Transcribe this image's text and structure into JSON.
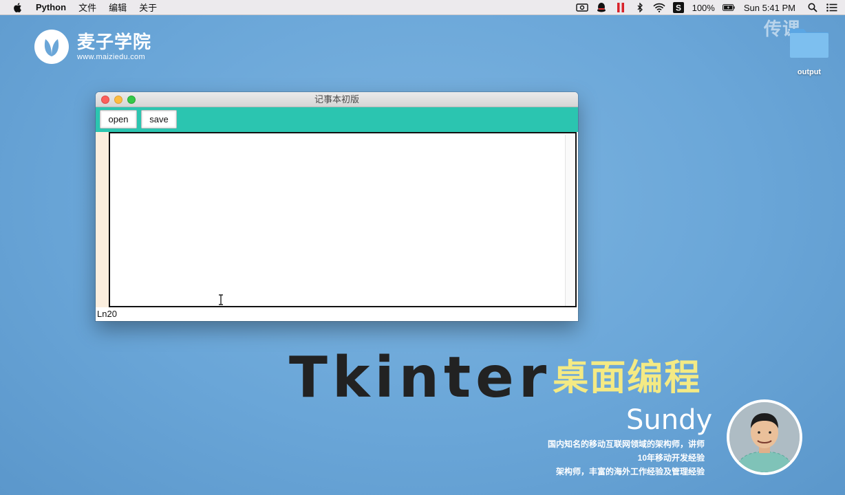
{
  "menubar": {
    "app_name": "Python",
    "items": [
      "文件",
      "编辑",
      "关于"
    ],
    "status": {
      "battery": "100%",
      "clock": "Sun 5:41 PM"
    }
  },
  "desktop": {
    "logo": {
      "title": "麦子学院",
      "url": "www.maiziedu.com"
    },
    "watermark": "传课",
    "folder_label": "output"
  },
  "window": {
    "title": "记事本初版",
    "toolbar": {
      "open_label": "open",
      "save_label": "save"
    },
    "text_value": "",
    "status_text": "Ln20",
    "toolbar_color": "#2bc5b0",
    "gutter_color": "#fbeede"
  },
  "banner": {
    "title_en": "Tkinter",
    "title_cn": "桌面编程",
    "presenter": "Sundy",
    "bio": [
      "国内知名的移动互联网领域的架构师，讲师",
      "10年移动开发经验",
      "架构师，丰富的海外工作经验及管理经验"
    ]
  }
}
